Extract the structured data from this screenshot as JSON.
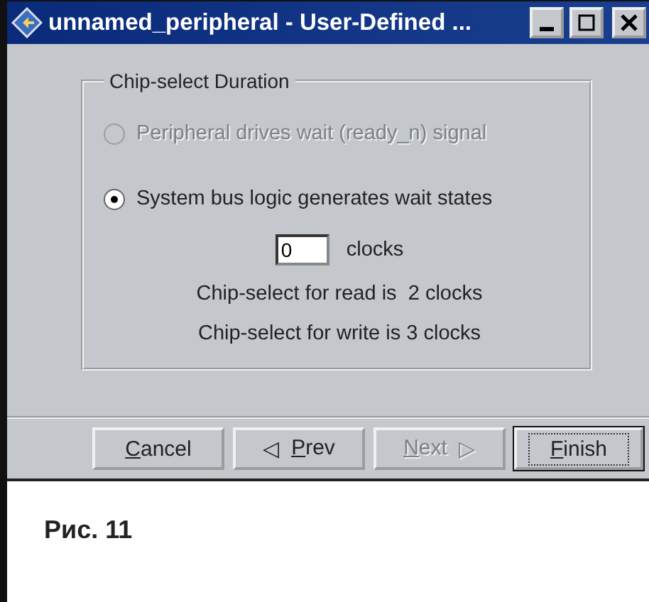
{
  "window": {
    "title": "unnamed_peripheral - User-Defined ..."
  },
  "group": {
    "title": "Chip-select Duration",
    "options": [
      {
        "label": "Peripheral drives wait (ready_n) signal",
        "selected": false,
        "disabled": true
      },
      {
        "label": "System bus logic generates wait states",
        "selected": true,
        "disabled": false
      }
    ],
    "wait_field": {
      "value": "0",
      "unit": "clocks"
    },
    "notes": [
      "Chip-select for read is  2 clocks",
      "Chip-select for write is 3 clocks"
    ]
  },
  "buttons": [
    {
      "accel": "C",
      "rest": "ancel",
      "disabled": false,
      "default": false
    },
    {
      "accel": "P",
      "rest": "rev",
      "arrow_before": "◁",
      "disabled": false,
      "default": false
    },
    {
      "accel": "N",
      "rest": "ext",
      "arrow_after": "▷",
      "disabled": true,
      "default": false
    },
    {
      "accel": "F",
      "rest": "inish",
      "disabled": false,
      "default": true
    }
  ],
  "caption": "Рис. 11"
}
